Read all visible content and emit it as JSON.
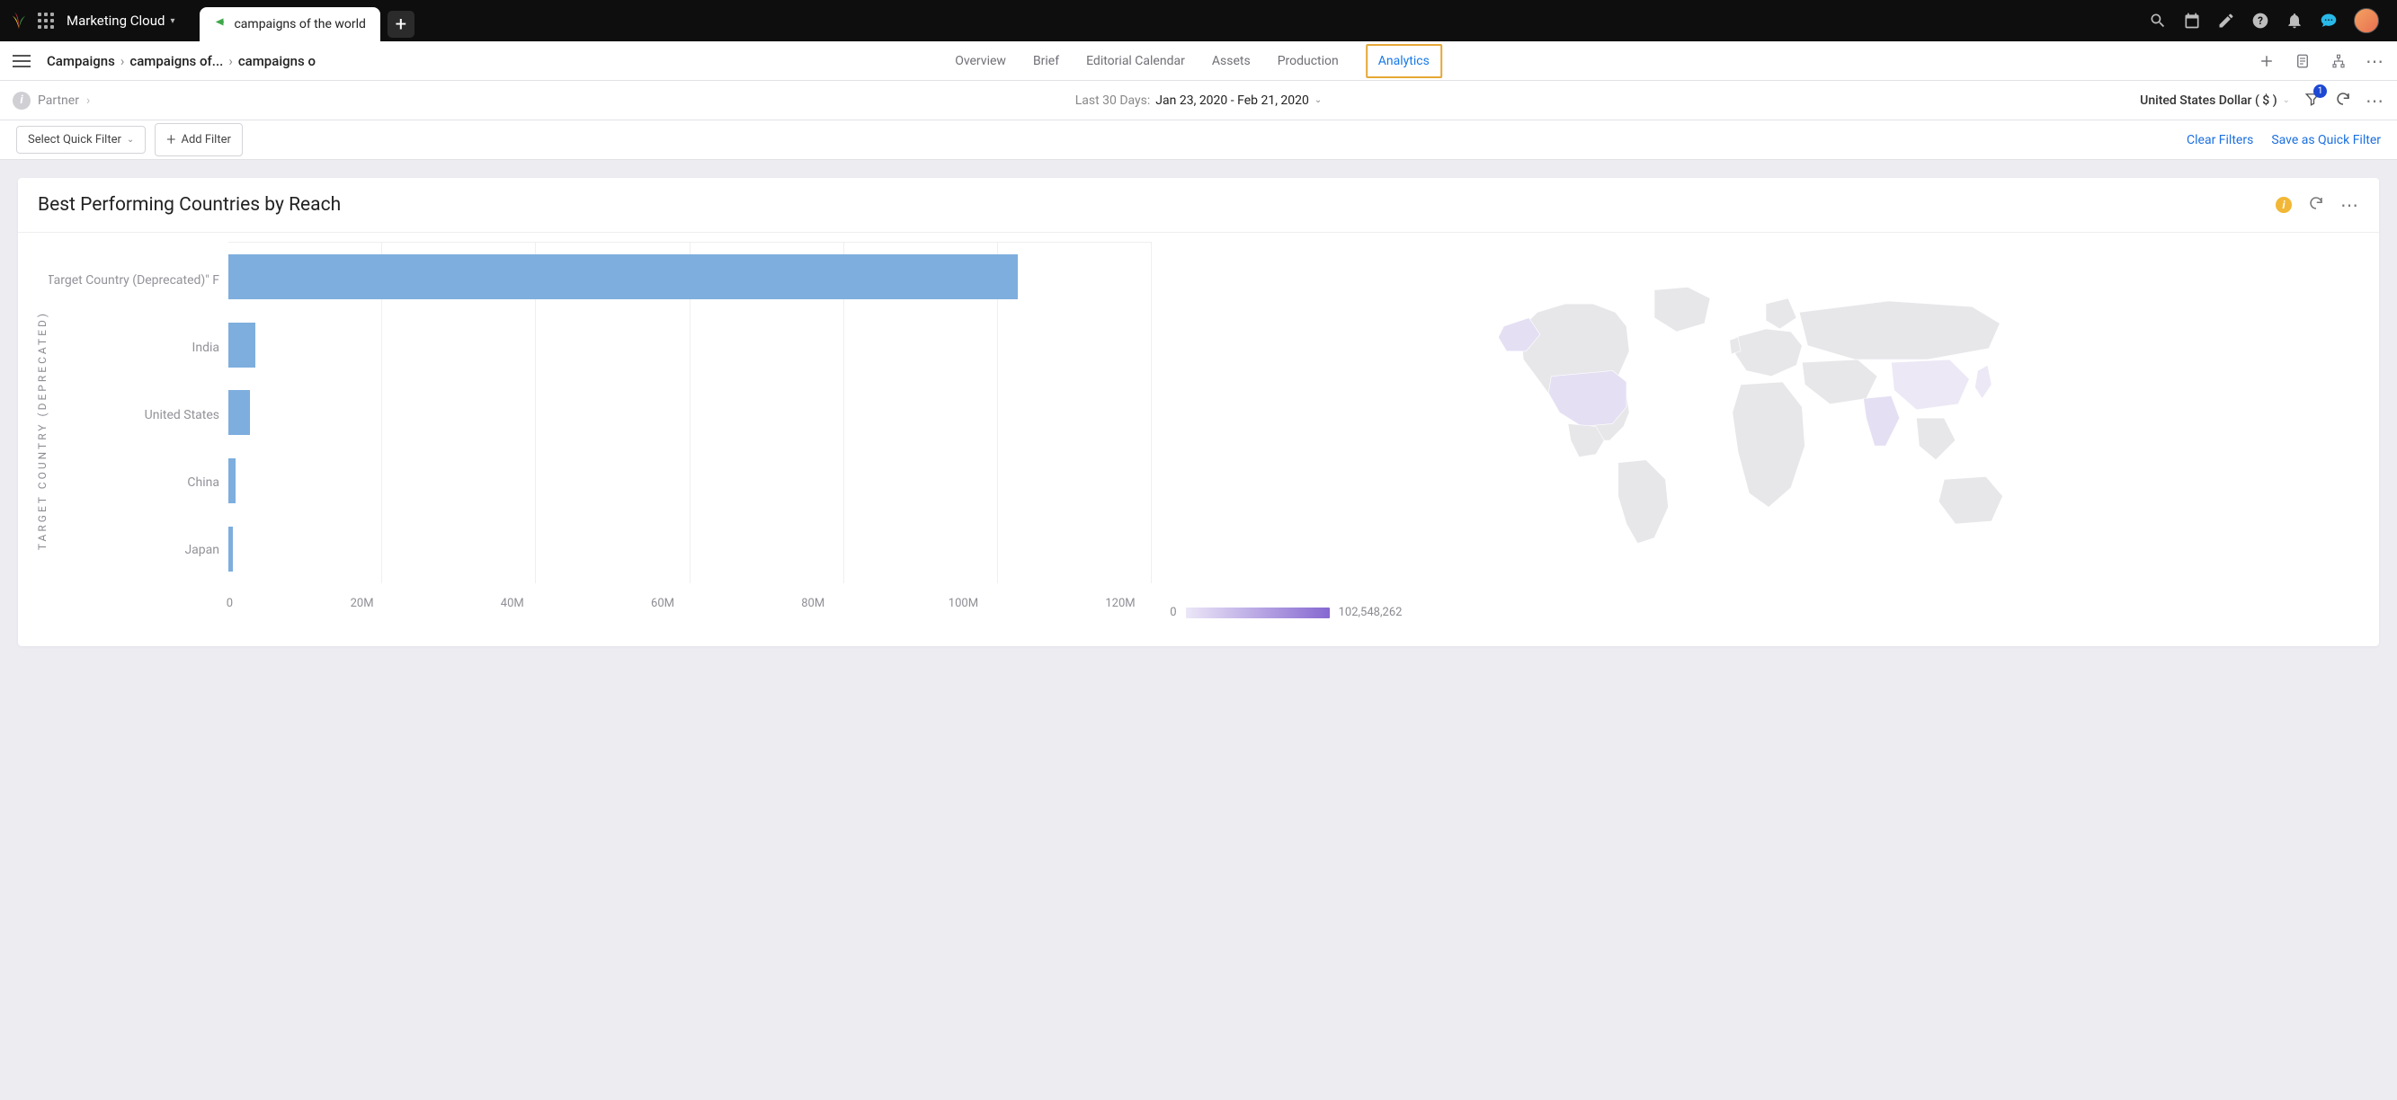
{
  "topbar": {
    "product_label": "Marketing Cloud",
    "active_tab": "campaigns of the world"
  },
  "navbar": {
    "breadcrumbs": [
      "Campaigns",
      "campaigns of...",
      "campaigns o"
    ],
    "items": [
      "Overview",
      "Brief",
      "Editorial Calendar",
      "Assets",
      "Production",
      "Analytics"
    ],
    "active_item": "Analytics"
  },
  "infoline": {
    "partner_label": "Partner",
    "date_prefix": "Last 30 Days:",
    "date_range": "Jan 23, 2020 - Feb 21, 2020",
    "currency_label": "United States Dollar ( $ )",
    "filter_badge": "1"
  },
  "filterbar": {
    "quick_filter_label": "Select Quick Filter",
    "add_filter_label": "Add Filter",
    "clear_label": "Clear Filters",
    "save_label": "Save as Quick Filter"
  },
  "panel": {
    "title": "Best Performing Countries by Reach"
  },
  "chart_data": {
    "type": "bar",
    "orientation": "horizontal",
    "ylabel": "TARGET COUNTRY (DEPRECATED)",
    "categories": [
      "NO \"Target Country (Deprecated)\" F",
      "India",
      "United States",
      "China",
      "Japan"
    ],
    "values": [
      102548262,
      3500000,
      2800000,
      900000,
      500000
    ],
    "x_ticks": [
      "0",
      "20M",
      "40M",
      "60M",
      "80M",
      "100M",
      "120M"
    ],
    "x_max": 120000000
  },
  "map_legend": {
    "min": "0",
    "max": "102,548,262"
  }
}
